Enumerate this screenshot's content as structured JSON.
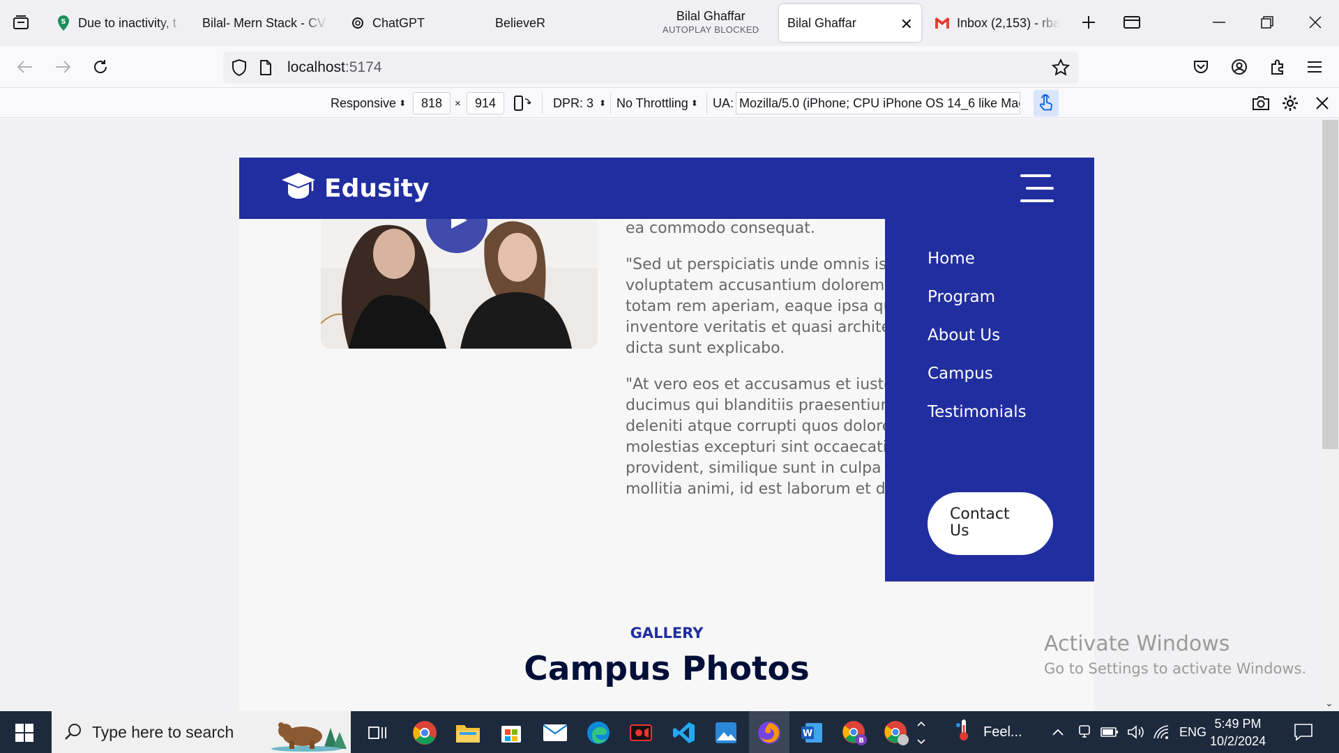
{
  "browser": {
    "tabs": [
      {
        "title": "Due to inactivity, t",
        "icon": "location-pin-icon",
        "subtitle": ""
      },
      {
        "title": "Bilal- Mern Stack - CV",
        "icon": "",
        "subtitle": ""
      },
      {
        "title": "ChatGPT",
        "icon": "chatgpt-icon",
        "subtitle": ""
      },
      {
        "title": "BelieveR",
        "icon": "",
        "subtitle": ""
      },
      {
        "title": "Bilal Ghaffar",
        "icon": "",
        "subtitle": "AUTOPLAY BLOCKED"
      },
      {
        "title": "Bilal Ghaffar",
        "icon": "",
        "subtitle": ""
      },
      {
        "title": "Inbox (2,153) - rba",
        "icon": "gmail-icon",
        "subtitle": ""
      }
    ],
    "url_host": "localhost",
    "url_port": ":5174"
  },
  "rdm": {
    "device": "Responsive",
    "width": "818",
    "times": "×",
    "height": "914",
    "dpr": "DPR: 3",
    "throttling": "No Throttling",
    "ua_label": "UA:",
    "ua_value": "Mozilla/5.0 (iPhone; CPU iPhone OS 14_6 like Mac"
  },
  "site": {
    "brand": "Edusity",
    "paragraphs": [
      [
        "ea commodo consequat."
      ],
      [
        "\"Sed ut perspiciatis unde omnis iste",
        "voluptatem accusantium doloremqu",
        "totam rem aperiam, eaque ipsa quo",
        "inventore veritatis et quasi architect",
        "dicta sunt explicabo."
      ],
      [
        "\"At vero eos et accusamus et iusto o",
        "ducimus qui blanditiis praesentium v",
        "deleniti atque corrupti quos dolores",
        "molestias excepturi sint occaecati c",
        "provident, similique sunt in culpa qu",
        "mollitia animi, id est laborum et dolo"
      ]
    ],
    "menu": [
      "Home",
      "Program",
      "About Us",
      "Campus",
      "Testimonials"
    ],
    "cta": [
      "Contact",
      "Us"
    ],
    "gallery_label": "GALLERY",
    "gallery_title": "Campus Photos",
    "brand_color": "#212ea0"
  },
  "watermark": {
    "line1": "Activate Windows",
    "line2": "Go to Settings to activate Windows."
  },
  "taskbar": {
    "search_placeholder": "Type here to search",
    "weather": "Feel...",
    "lang": "ENG",
    "time": "5:49 PM",
    "date": "10/2/2024"
  }
}
